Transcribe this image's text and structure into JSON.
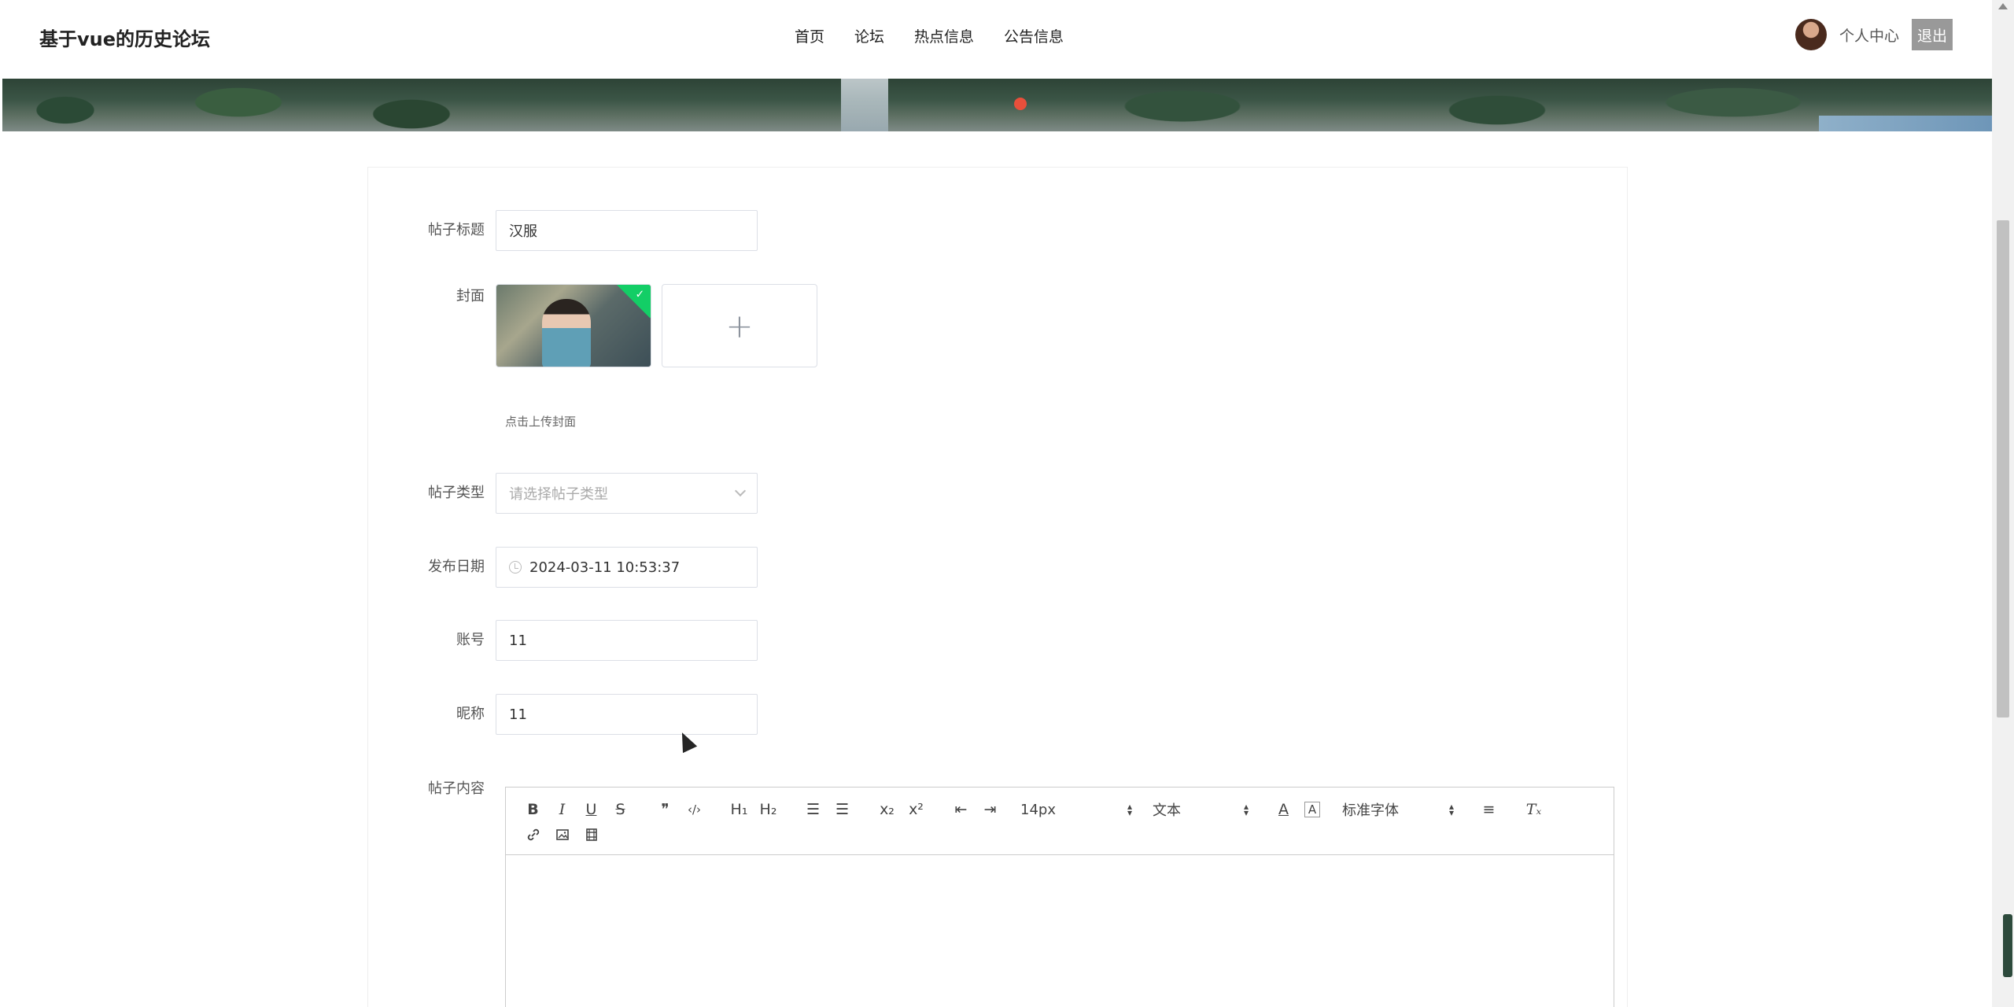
{
  "header": {
    "site_title": "基于vue的历史论坛",
    "nav": [
      "首页",
      "论坛",
      "热点信息",
      "公告信息"
    ],
    "user_center": "个人中心",
    "logout": "退出"
  },
  "form": {
    "title_label": "帖子标题",
    "title_value": "汉服",
    "cover_label": "封面",
    "cover_upload_plus": "+",
    "cover_hint": "点击上传封面",
    "type_label": "帖子类型",
    "type_placeholder": "请选择帖子类型",
    "date_label": "发布日期",
    "date_value": "2024-03-11 10:53:37",
    "account_label": "账号",
    "account_value": "11",
    "nickname_label": "昵称",
    "nickname_value": "11",
    "content_label": "帖子内容"
  },
  "editor": {
    "bold": "B",
    "italic": "I",
    "underline": "U",
    "strike": "S",
    "quote": "❞",
    "code": "‹/›",
    "h1": "H₁",
    "h2": "H₂",
    "ordered": "☰",
    "bullet": "☰",
    "sub": "x₂",
    "sup": "x²",
    "outdent": "⇤",
    "indent": "⇥",
    "size": "14px",
    "header": "文本",
    "color": "A",
    "background": "A",
    "font": "标准字体",
    "align": "≡",
    "clean": "Tₓ"
  },
  "colors": {
    "accent_dot": "#e94f3b",
    "check_badge": "#13ce66",
    "logout_bg": "#999999"
  }
}
